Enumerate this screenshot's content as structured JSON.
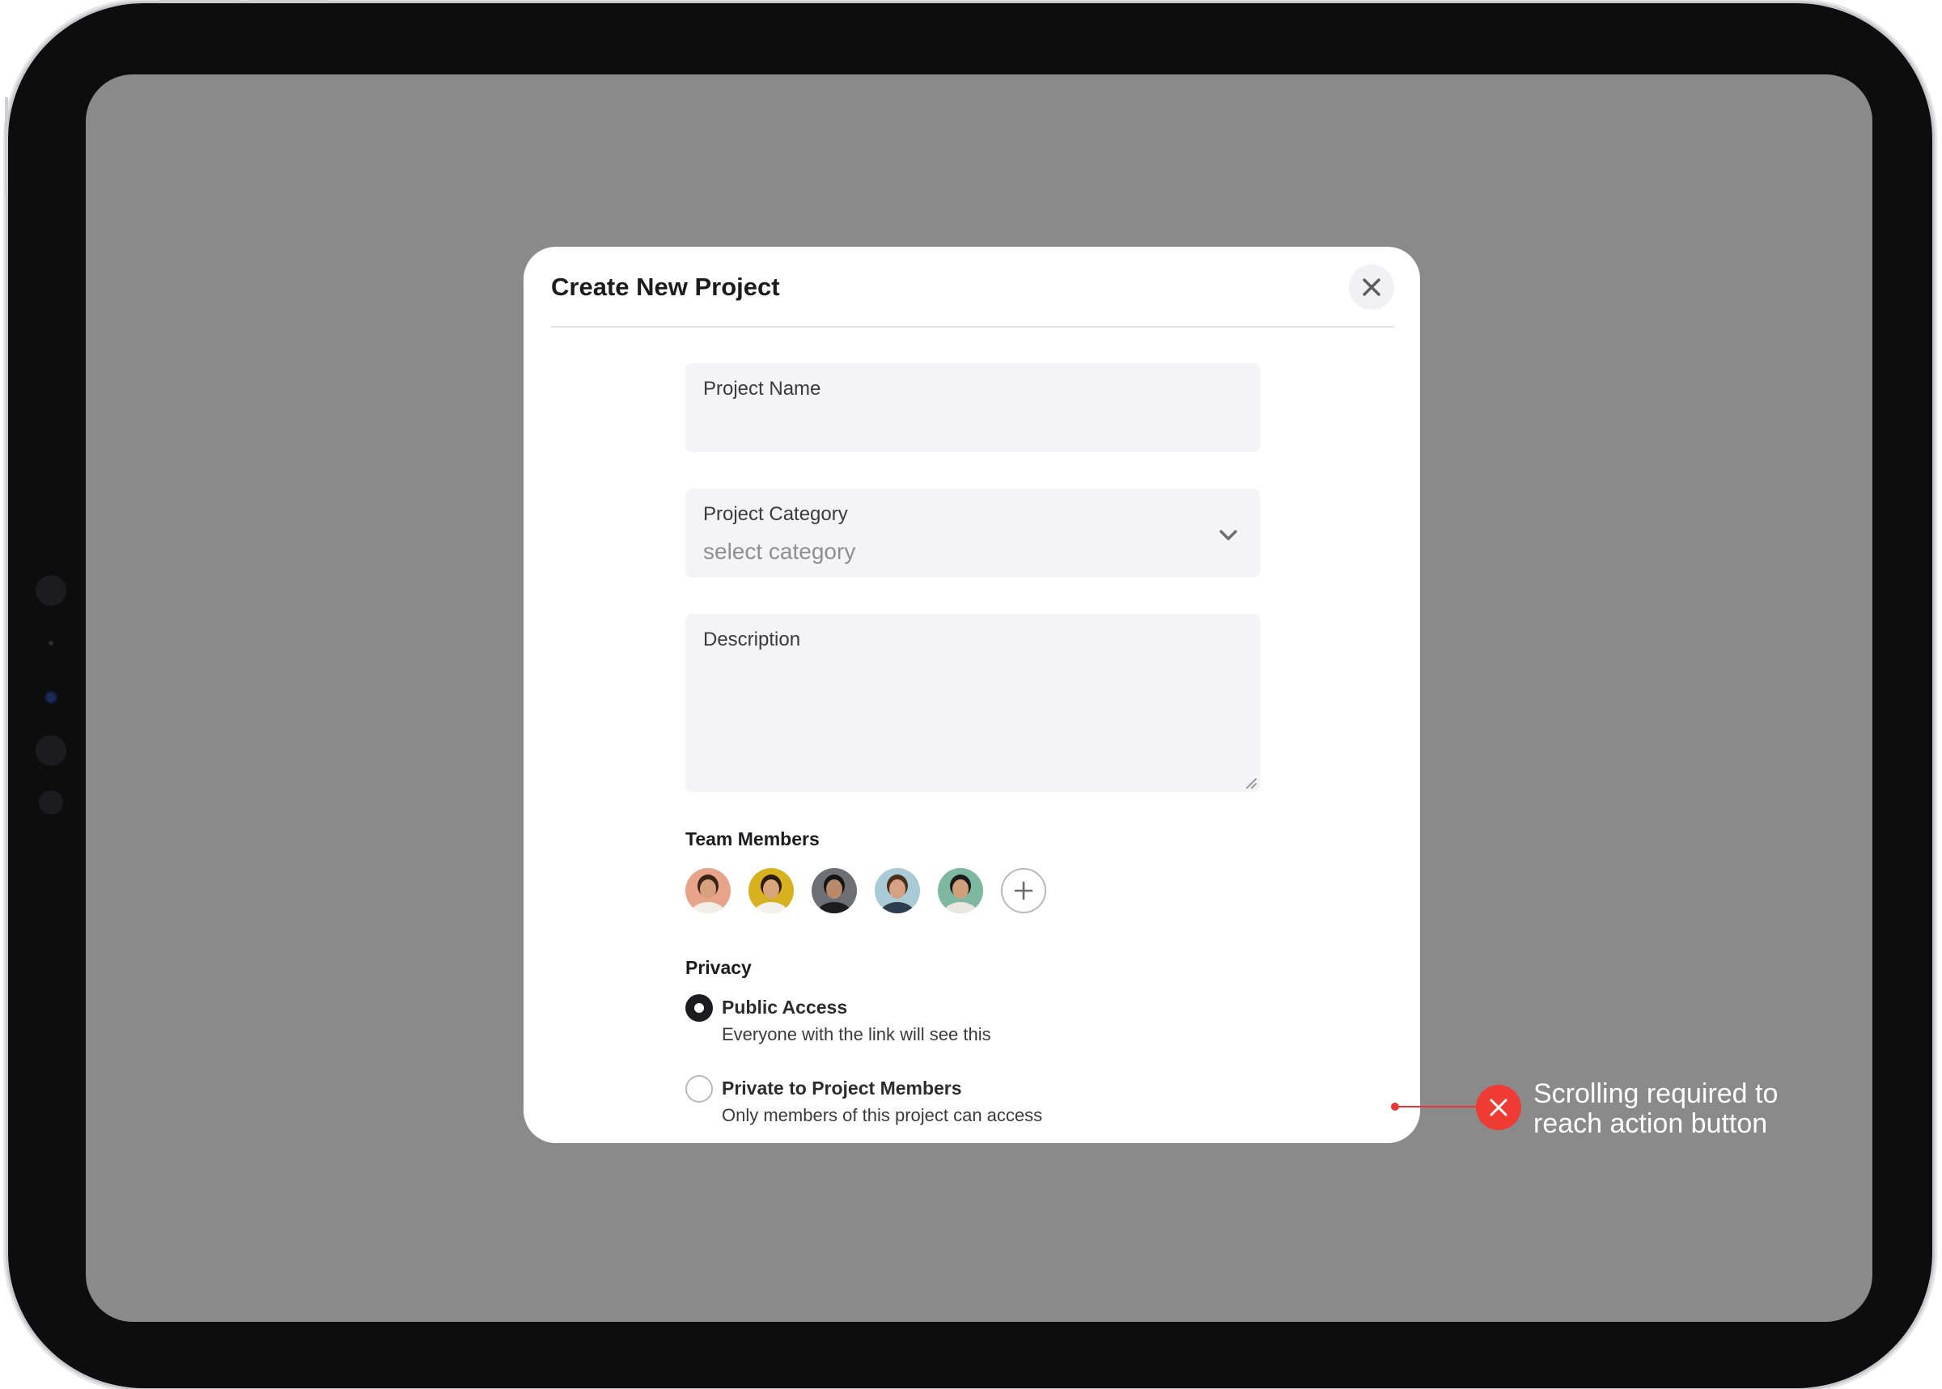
{
  "modal": {
    "title": "Create New Project"
  },
  "form": {
    "project_name": {
      "label": "Project Name",
      "value": ""
    },
    "project_category": {
      "label": "Project Category",
      "placeholder": "select category"
    },
    "description": {
      "label": "Description",
      "value": ""
    }
  },
  "team": {
    "label": "Team Members",
    "members": [
      {
        "bg": "#e8a48a",
        "skin": "#d9a07e",
        "hair": "#3a2418",
        "shirt": "#f2efe9"
      },
      {
        "bg": "#d8b21e",
        "skin": "#d9a57a",
        "hair": "#2b1a10",
        "shirt": "#f4f1ea"
      },
      {
        "bg": "#6d6f74",
        "skin": "#b98a6a",
        "hair": "#141414",
        "shirt": "#1c1c1e"
      },
      {
        "bg": "#a9cbd6",
        "skin": "#d6a283",
        "hair": "#4a2f1d",
        "shirt": "#2c3e50"
      },
      {
        "bg": "#7eb8a3",
        "skin": "#d0a07c",
        "hair": "#1b1b1b",
        "shirt": "#e9e6df"
      }
    ]
  },
  "privacy": {
    "label": "Privacy",
    "options": [
      {
        "title": "Public Access",
        "description": "Everyone with the link will see this",
        "selected": true
      },
      {
        "title": "Private to Project Members",
        "description": "Only members of this project can access",
        "selected": false
      }
    ]
  },
  "annotation": {
    "text": "Scrolling required to reach action button",
    "color": "#ef3b34"
  },
  "colors": {
    "overlay": "#8a8a8a",
    "field_bg": "#f4f4f6",
    "text_primary": "#1c1c1e"
  },
  "icons": [
    "close-icon",
    "chevron-down-icon",
    "plus-icon",
    "resize-handle-icon",
    "error-x-icon"
  ]
}
